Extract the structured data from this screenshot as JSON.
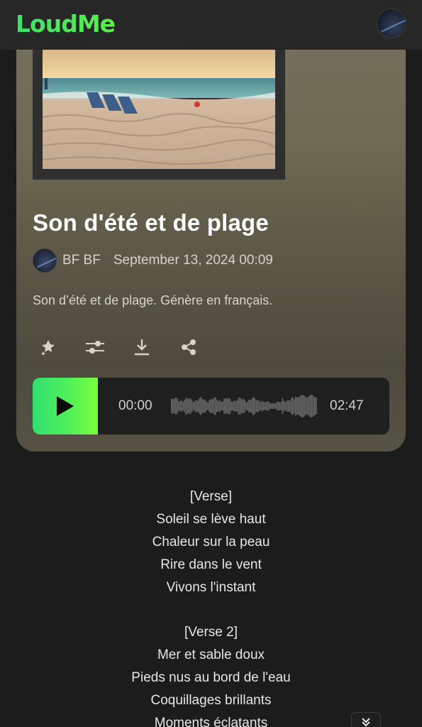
{
  "header": {
    "logo": "LoudMe"
  },
  "song": {
    "title": "Son d'été et de plage",
    "author": "BF BF",
    "date": "September 13, 2024 00:09",
    "description": "Son d’été et de plage. Génère en français."
  },
  "actions": [
    {
      "icon": "magic-pin-icon"
    },
    {
      "icon": "sliders-icon"
    },
    {
      "icon": "download-icon"
    },
    {
      "icon": "share-icon"
    }
  ],
  "player": {
    "current_time": "00:00",
    "duration": "02:47",
    "progress": 0
  },
  "lyrics": {
    "verse1_header": "[Verse]",
    "verse1": [
      "Soleil se lève haut",
      "Chaleur sur la peau",
      "Rire dans le vent",
      "Vivons l'instant"
    ],
    "verse2_header": "[Verse 2]",
    "verse2": [
      "Mer et sable doux",
      "Pieds nus au bord de l'eau",
      "Coquillages brillants",
      "Moments éclatants"
    ]
  },
  "colors": {
    "accent": "#4ff05a",
    "background": "#1c1c1c",
    "header": "#272727"
  }
}
